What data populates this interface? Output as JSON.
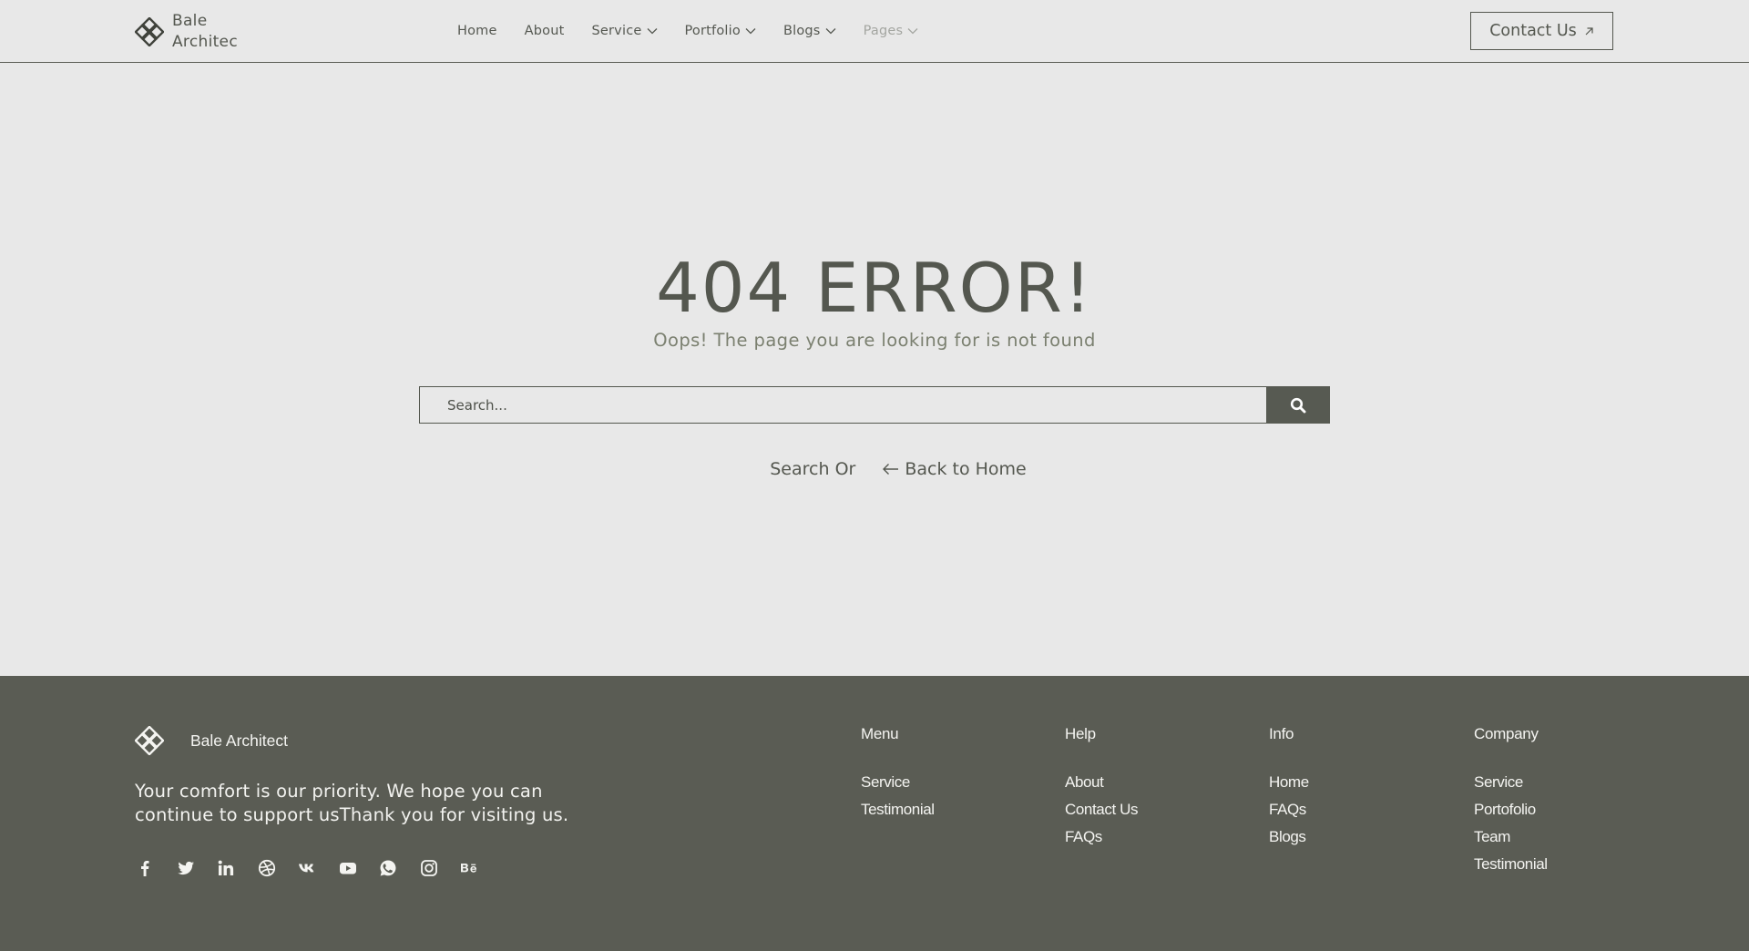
{
  "header": {
    "logo_text": "Bale Architec",
    "nav": [
      {
        "label": "Home",
        "has_dropdown": false
      },
      {
        "label": "About",
        "has_dropdown": false
      },
      {
        "label": "Service",
        "has_dropdown": true
      },
      {
        "label": "Portfolio",
        "has_dropdown": true
      },
      {
        "label": "Blogs",
        "has_dropdown": true
      },
      {
        "label": "Pages",
        "has_dropdown": true
      }
    ],
    "contact_label": "Contact Us"
  },
  "main": {
    "title": "404 ERROR!",
    "subtitle": "Oops! The page you are looking for is not found",
    "search_placeholder": "Search...",
    "search_or": "Search Or",
    "back_label": "Back to Home"
  },
  "footer": {
    "logo_text": "Bale Architect",
    "tagline": "Your comfort is our priority. We hope you can continue to support usThank you for visiting us.",
    "social": [
      "facebook-icon",
      "twitter-icon",
      "linkedin-icon",
      "dribbble-icon",
      "vk-icon",
      "youtube-icon",
      "whatsapp-icon",
      "instagram-icon",
      "behance-icon"
    ],
    "columns": [
      {
        "title": "Menu",
        "items": [
          "Service",
          "Testimonial"
        ]
      },
      {
        "title": "Help",
        "items": [
          "About",
          "Contact Us",
          "FAQs"
        ]
      },
      {
        "title": "Info",
        "items": [
          "Home",
          "FAQs",
          "Blogs"
        ]
      },
      {
        "title": "Company",
        "items": [
          "Service",
          "Portofolio",
          "Team",
          "Testimonial"
        ]
      }
    ]
  },
  "colors": {
    "background": "#e8e8e8",
    "primary": "#54574f",
    "footer_bg": "#5a5c54",
    "subtitle": "#7b8070",
    "nav_muted": "#a4a6a1"
  }
}
